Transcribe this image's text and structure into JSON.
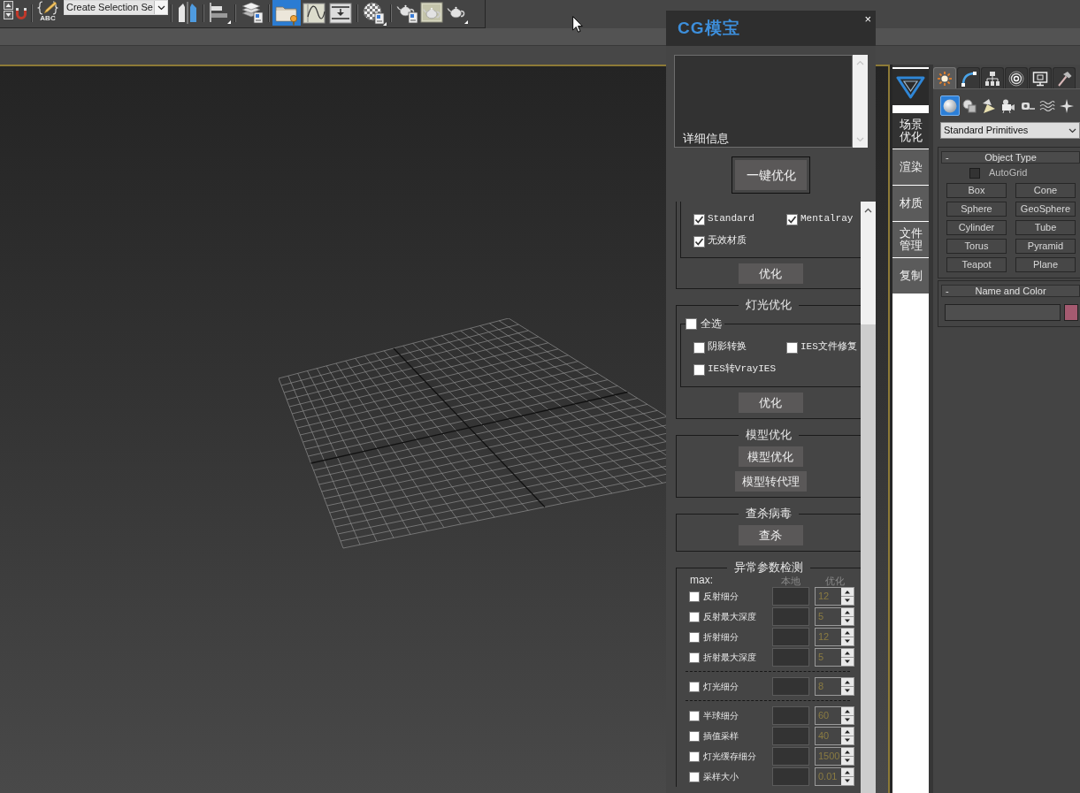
{
  "toolbar": {
    "groups": [
      {
        "buttons": [
          {
            "kind": "spinner",
            "pressed": false
          },
          {
            "kind": "magnet",
            "pressed": false
          }
        ]
      },
      {
        "buttons": [
          {
            "kind": "named_selection",
            "pressed": false,
            "caption": "ABC"
          }
        ],
        "dropdown": {
          "value": "Create Selection Se"
        }
      },
      {
        "buttons": [
          {
            "kind": "mirror",
            "pressed": false
          }
        ]
      },
      {
        "buttons": [
          {
            "kind": "align",
            "pressed": false
          }
        ]
      },
      {
        "buttons": [
          {
            "kind": "layers",
            "pressed": false
          }
        ]
      },
      {
        "buttons": [
          {
            "kind": "explorer",
            "pressed": true
          },
          {
            "kind": "curve_editor",
            "pressed": false
          },
          {
            "kind": "schematic",
            "pressed": false
          }
        ]
      },
      {
        "buttons": [
          {
            "kind": "material_editor",
            "pressed": false
          }
        ]
      },
      {
        "buttons": [
          {
            "kind": "render_setup",
            "pressed": false
          },
          {
            "kind": "frame_window",
            "pressed": false
          },
          {
            "kind": "render",
            "pressed": false
          }
        ]
      }
    ]
  },
  "plugin_panel": {
    "logo": "CG模宝",
    "close": "×",
    "details": "详细信息",
    "main_button": "一键优化",
    "sections": [
      {
        "kind": "options",
        "options": [
          {
            "label": "Standard",
            "checked": true
          },
          {
            "label": "Mentalray",
            "checked": true
          },
          {
            "label": "无效材质",
            "checked": true
          }
        ],
        "button": "优化"
      },
      {
        "kind": "options",
        "legend": "灯光优化",
        "select_all": {
          "label": "全选",
          "checked": false
        },
        "options": [
          {
            "label": "阴影转换",
            "checked": false
          },
          {
            "label": "IES文件修复",
            "checked": false
          },
          {
            "label": "IES转VrayIES",
            "checked": false
          }
        ],
        "button": "优化"
      },
      {
        "kind": "buttons",
        "legend": "模型优化",
        "buttons": [
          "模型优化",
          "模型转代理"
        ]
      },
      {
        "kind": "buttons",
        "legend": "查杀病毒",
        "buttons": [
          "查杀"
        ]
      },
      {
        "kind": "params",
        "legend": "异常参数检测",
        "header": {
          "label": "max:",
          "local": "本地",
          "optimized": "优化"
        },
        "groups": [
          {
            "rows": [
              {
                "label": "反射细分",
                "checked": false,
                "value": "12"
              },
              {
                "label": "反射最大深度",
                "checked": false,
                "value": "5"
              },
              {
                "label": "折射细分",
                "checked": false,
                "value": "12"
              },
              {
                "label": "折射最大深度",
                "checked": false,
                "value": "5"
              }
            ]
          },
          {
            "rows": [
              {
                "label": "灯光细分",
                "checked": false,
                "value": "8"
              }
            ]
          },
          {
            "rows": [
              {
                "label": "半球细分",
                "checked": false,
                "value": "60"
              },
              {
                "label": "插值采样",
                "checked": false,
                "value": "40"
              },
              {
                "label": "灯光缓存细分",
                "checked": false,
                "value": "1500"
              },
              {
                "label": "采样大小",
                "checked": false,
                "value": "0.01"
              }
            ]
          }
        ]
      }
    ]
  },
  "cg_sidebar": {
    "tabs": [
      {
        "label": "场景优化",
        "selected": true
      },
      {
        "label": "渲染",
        "selected": false
      },
      {
        "label": "材质",
        "selected": false
      },
      {
        "label": "文件管理",
        "selected": false
      },
      {
        "label": "复制",
        "selected": false
      }
    ]
  },
  "command_panel": {
    "tabs": [
      {
        "kind": "create",
        "selected": true
      },
      {
        "kind": "modify",
        "selected": false
      },
      {
        "kind": "hierarchy",
        "selected": false
      },
      {
        "kind": "motion",
        "selected": false
      },
      {
        "kind": "display",
        "selected": false
      },
      {
        "kind": "utilities",
        "selected": false
      }
    ],
    "categories": [
      {
        "kind": "geometry",
        "selected": true
      },
      {
        "kind": "shapes",
        "selected": false
      },
      {
        "kind": "lights",
        "selected": false
      },
      {
        "kind": "cameras",
        "selected": false
      },
      {
        "kind": "helpers",
        "selected": false
      },
      {
        "kind": "space_warps",
        "selected": false
      },
      {
        "kind": "systems",
        "selected": false
      }
    ],
    "dropdown": {
      "value": "Standard Primitives"
    },
    "rollouts": [
      {
        "kind": "object_type",
        "toggle": "-",
        "title": "Object Type",
        "autogrid": {
          "label": "AutoGrid",
          "checked": false
        },
        "buttons": [
          "Box",
          "Cone",
          "Sphere",
          "GeoSphere",
          "Cylinder",
          "Tube",
          "Torus",
          "Pyramid",
          "Teapot",
          "Plane"
        ]
      },
      {
        "kind": "name_color",
        "toggle": "-",
        "title": "Name and Color",
        "color": "#a55a70"
      }
    ]
  }
}
